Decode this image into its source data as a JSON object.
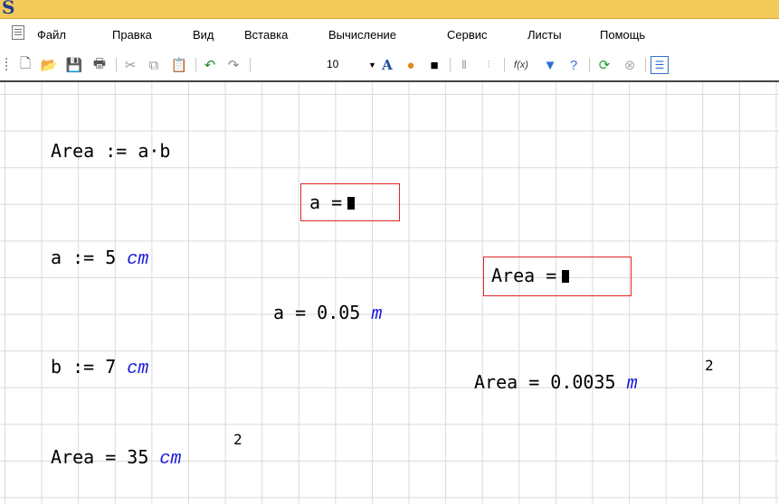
{
  "app": {
    "logo": "S"
  },
  "menu": {
    "items": [
      "Файл",
      "Правка",
      "Вид",
      "Вставка",
      "Вычисление",
      "Сервис",
      "Листы",
      "Помощь"
    ]
  },
  "toolbar": {
    "font_size": "10",
    "function_label": "f(x)"
  },
  "sheet": {
    "area_def": "Area := a·b",
    "a_eval_empty": "a =",
    "a_def": "a := 5",
    "a_def_unit": "cm",
    "area_eval_empty": "Area =",
    "a_eval": "a = 0.05",
    "a_eval_unit": "m",
    "b_def": "b := 7",
    "b_def_unit": "cm",
    "area_eval_m": "Area = 0.0035",
    "area_eval_m_unit": "m",
    "area_eval_m_exp": "2",
    "area_eval_cm": "Area = 35",
    "area_eval_cm_unit": "cm",
    "area_eval_cm_exp": "2"
  }
}
